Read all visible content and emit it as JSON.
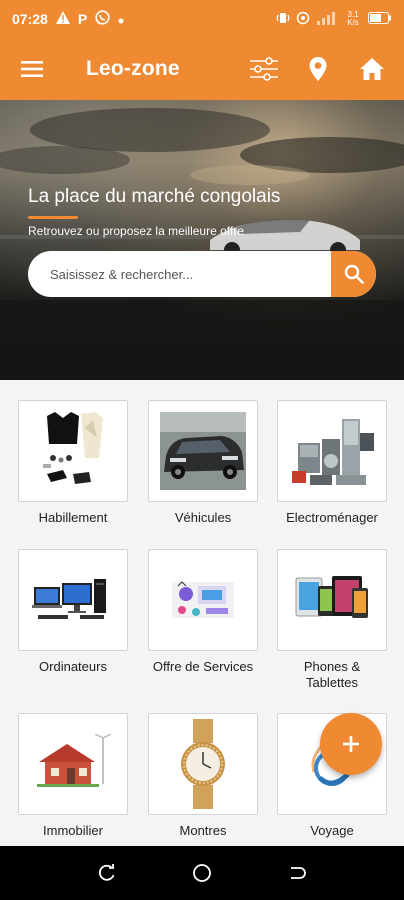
{
  "status_bar": {
    "time": "07:28",
    "battery_text": "3.1 K/s",
    "icons": [
      "warning-icon",
      "parking-icon",
      "whatsapp-icon",
      "dot-icon",
      "vibrate-icon",
      "hotspot-icon",
      "signal-icon",
      "battery-icon"
    ]
  },
  "app_bar": {
    "title": "Leo-zone",
    "icons": [
      "menu-icon",
      "filter-icon",
      "location-icon",
      "home-icon"
    ]
  },
  "hero": {
    "title": "La place du marché congolais",
    "subtitle": "Retrouvez ou proposez la meilleure offre",
    "search": {
      "placeholder": "Saisissez & rechercher...",
      "value": ""
    }
  },
  "categories": [
    {
      "label": "Habillement",
      "icon": "clothing-icon"
    },
    {
      "label": "Véhicules",
      "icon": "car-icon"
    },
    {
      "label": "Electroménager",
      "icon": "appliances-icon"
    },
    {
      "label": "Ordinateurs",
      "icon": "computers-icon"
    },
    {
      "label": "Offre de Services",
      "icon": "services-icon"
    },
    {
      "label": "Phones &\nTablettes",
      "icon": "phones-icon"
    },
    {
      "label": "Immobilier",
      "icon": "house-icon"
    },
    {
      "label": "Montres",
      "icon": "watch-icon"
    },
    {
      "label": "Voyage",
      "icon": "travel-icon"
    }
  ],
  "fab": {
    "icon": "plus-icon"
  },
  "colors": {
    "accent": "#ef8a33",
    "nav": "#000000"
  },
  "nav_bar": {
    "icons": [
      "recents-icon",
      "home-circle-icon",
      "back-icon"
    ]
  }
}
